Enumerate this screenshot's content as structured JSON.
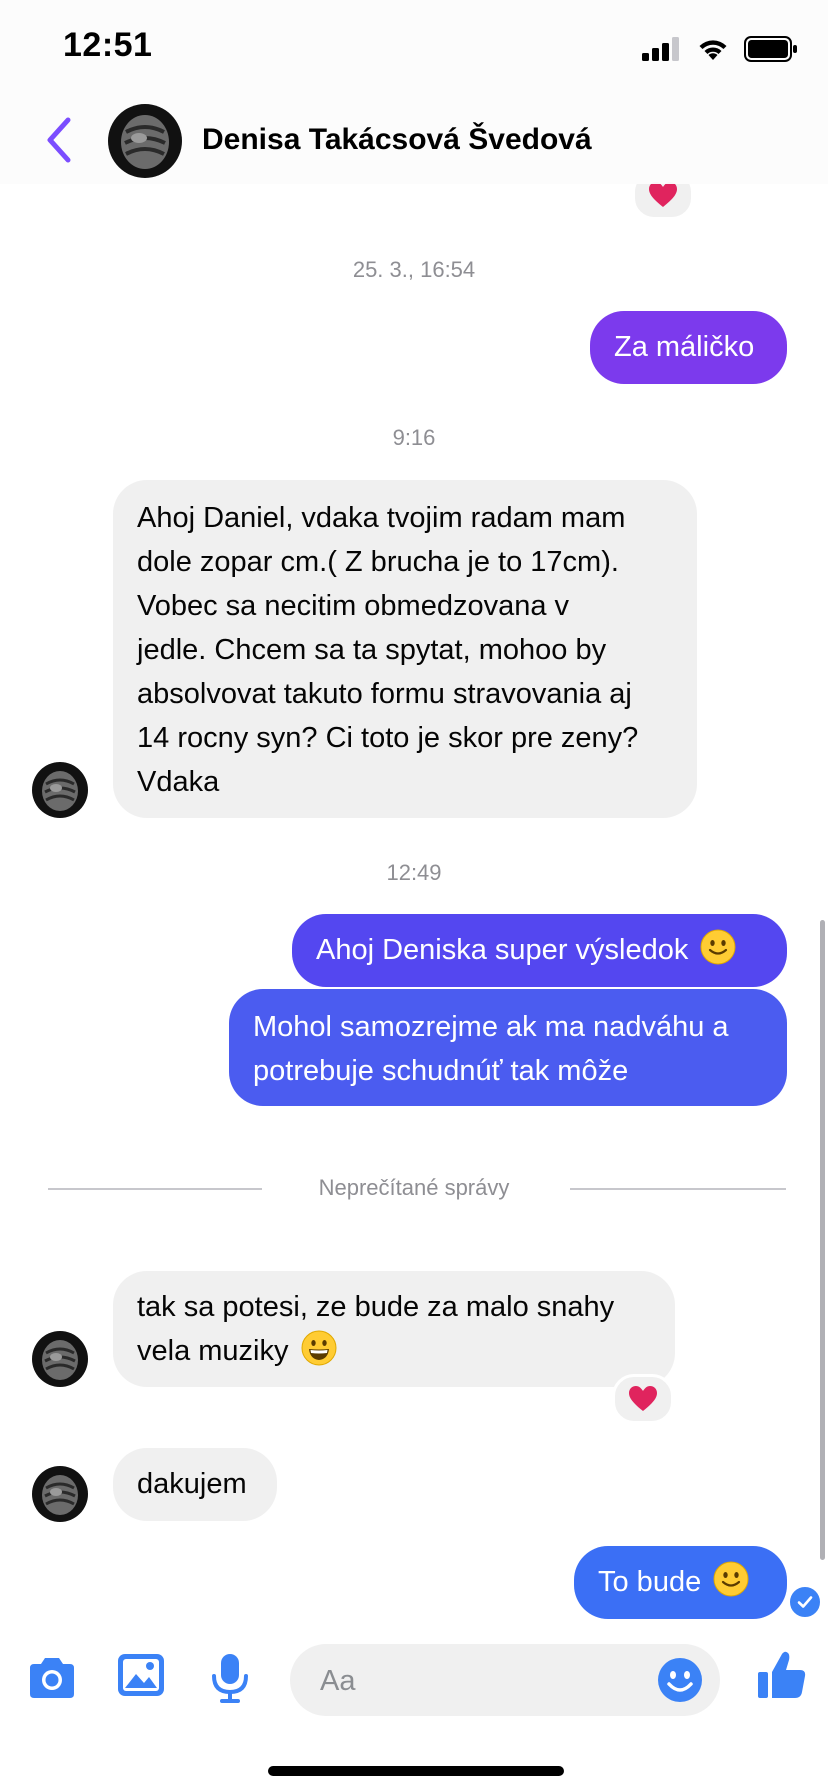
{
  "status_bar": {
    "time": "12:51"
  },
  "header": {
    "contact_name": "Denisa Takácsová Švedová"
  },
  "timestamps": {
    "t1": "25. 3., 16:54",
    "t2": "9:16",
    "t3": "12:49"
  },
  "messages": {
    "m1": {
      "text": "Za máličko",
      "direction": "outgoing"
    },
    "m2": {
      "lines": [
        "Ahoj Daniel, vdaka tvojim radam mam",
        "dole zopar cm.( Z brucha je to 17cm).",
        "Vobec sa necitim obmedzovana v",
        "jedle. Chcem sa ta spytat, mohoo by",
        "absolvovat takuto formu stravovania aj",
        "14 rocny syn? Ci toto je skor pre zeny?",
        "Vdaka"
      ],
      "direction": "incoming"
    },
    "m3": {
      "text": "Ahoj Deniska super výsledok",
      "emoji": "slightly-smiling-face-emoji",
      "direction": "outgoing"
    },
    "m4": {
      "lines": [
        "Mohol samozrejme ak ma nadváhu a",
        "potrebuje schudnúť tak môže"
      ],
      "direction": "outgoing"
    },
    "m5": {
      "lines": [
        "tak sa potesi, ze bude za malo snahy",
        "vela muziky"
      ],
      "emoji": "grinning-face-emoji",
      "reaction": "heart",
      "direction": "incoming"
    },
    "m6": {
      "text": "dakujem",
      "direction": "incoming"
    },
    "m7": {
      "text": "To bude",
      "emoji": "slightly-smiling-face-emoji",
      "direction": "outgoing"
    }
  },
  "unread_divider": {
    "label": "Neprečítané správy"
  },
  "composer": {
    "placeholder": "Aa",
    "value": ""
  },
  "colors": {
    "accent_purple": "#7b4dff",
    "bubble_purple": "#7c3aed",
    "bubble_indigo": "#4b5cf0",
    "bubble_blue": "#3b6ff5",
    "incoming_bubble": "#f0f0f0",
    "icon_blue": "#3b82f6",
    "heart_red": "#e0245e"
  }
}
